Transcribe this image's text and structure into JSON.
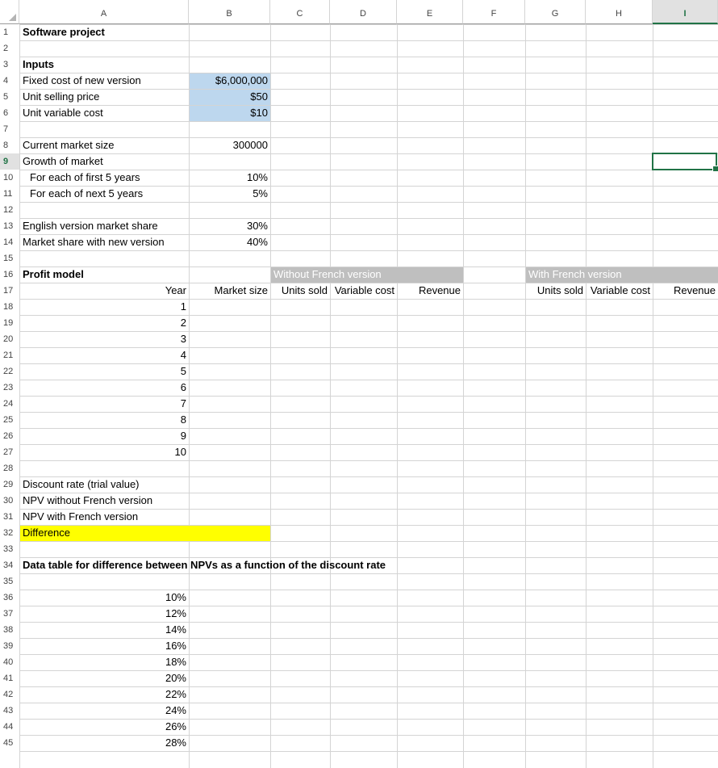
{
  "columns": [
    "A",
    "B",
    "C",
    "D",
    "E",
    "F",
    "G",
    "H",
    "I"
  ],
  "selected_column": "I",
  "selected_row": "9",
  "rows": [
    "1",
    "2",
    "3",
    "4",
    "5",
    "6",
    "7",
    "8",
    "9",
    "10",
    "11",
    "12",
    "13",
    "14",
    "15",
    "16",
    "17",
    "18",
    "19",
    "20",
    "21",
    "22",
    "23",
    "24",
    "25",
    "26",
    "27",
    "28",
    "29",
    "30",
    "31",
    "32",
    "33",
    "34",
    "35",
    "36",
    "37",
    "38",
    "39",
    "40",
    "41",
    "42",
    "43",
    "44",
    "45"
  ],
  "cells": {
    "title": "Software project",
    "inputs_heading": "Inputs",
    "fixed_cost_label": "Fixed cost of new version",
    "fixed_cost_value": "$6,000,000",
    "unit_price_label": "Unit selling price",
    "unit_price_value": "$50",
    "unit_var_cost_label": "Unit variable cost",
    "unit_var_cost_value": "$10",
    "market_size_label": "Current market size",
    "market_size_value": "300000",
    "growth_label": "Growth of market",
    "first5_label": "For each of first 5 years",
    "first5_value": "10%",
    "next5_label": "For each of next 5 years",
    "next5_value": "5%",
    "english_share_label": "English version market share",
    "english_share_value": "30%",
    "new_share_label": "Market share with new version",
    "new_share_value": "40%",
    "profit_model_heading": "Profit model",
    "without_french_header": "Without French version",
    "with_french_header": "With French version",
    "col_year": "Year",
    "col_market_size": "Market size",
    "col_units_sold_1": "Units sold",
    "col_variable_cost_1": "Variable cost",
    "col_revenue_1": "Revenue",
    "col_units_sold_2": "Units sold",
    "col_variable_cost_2": "Variable cost",
    "col_revenue_2": "Revenue",
    "discount_rate_label": "Discount rate (trial value)",
    "npv_without_label": "NPV without French version",
    "npv_with_label": "NPV with French version",
    "difference_label": "Difference",
    "data_table_heading": "Data table for difference between NPVs as a function of the discount rate"
  },
  "years": [
    "1",
    "2",
    "3",
    "4",
    "5",
    "6",
    "7",
    "8",
    "9",
    "10"
  ],
  "discount_rates": [
    "10%",
    "12%",
    "14%",
    "16%",
    "18%",
    "20%",
    "22%",
    "24%",
    "26%",
    "28%"
  ],
  "colors": {
    "input_fill": "#bdd7ee",
    "header_gray": "#bfbfbf",
    "highlight_yellow": "#ffff00",
    "selection_green": "#217346"
  }
}
